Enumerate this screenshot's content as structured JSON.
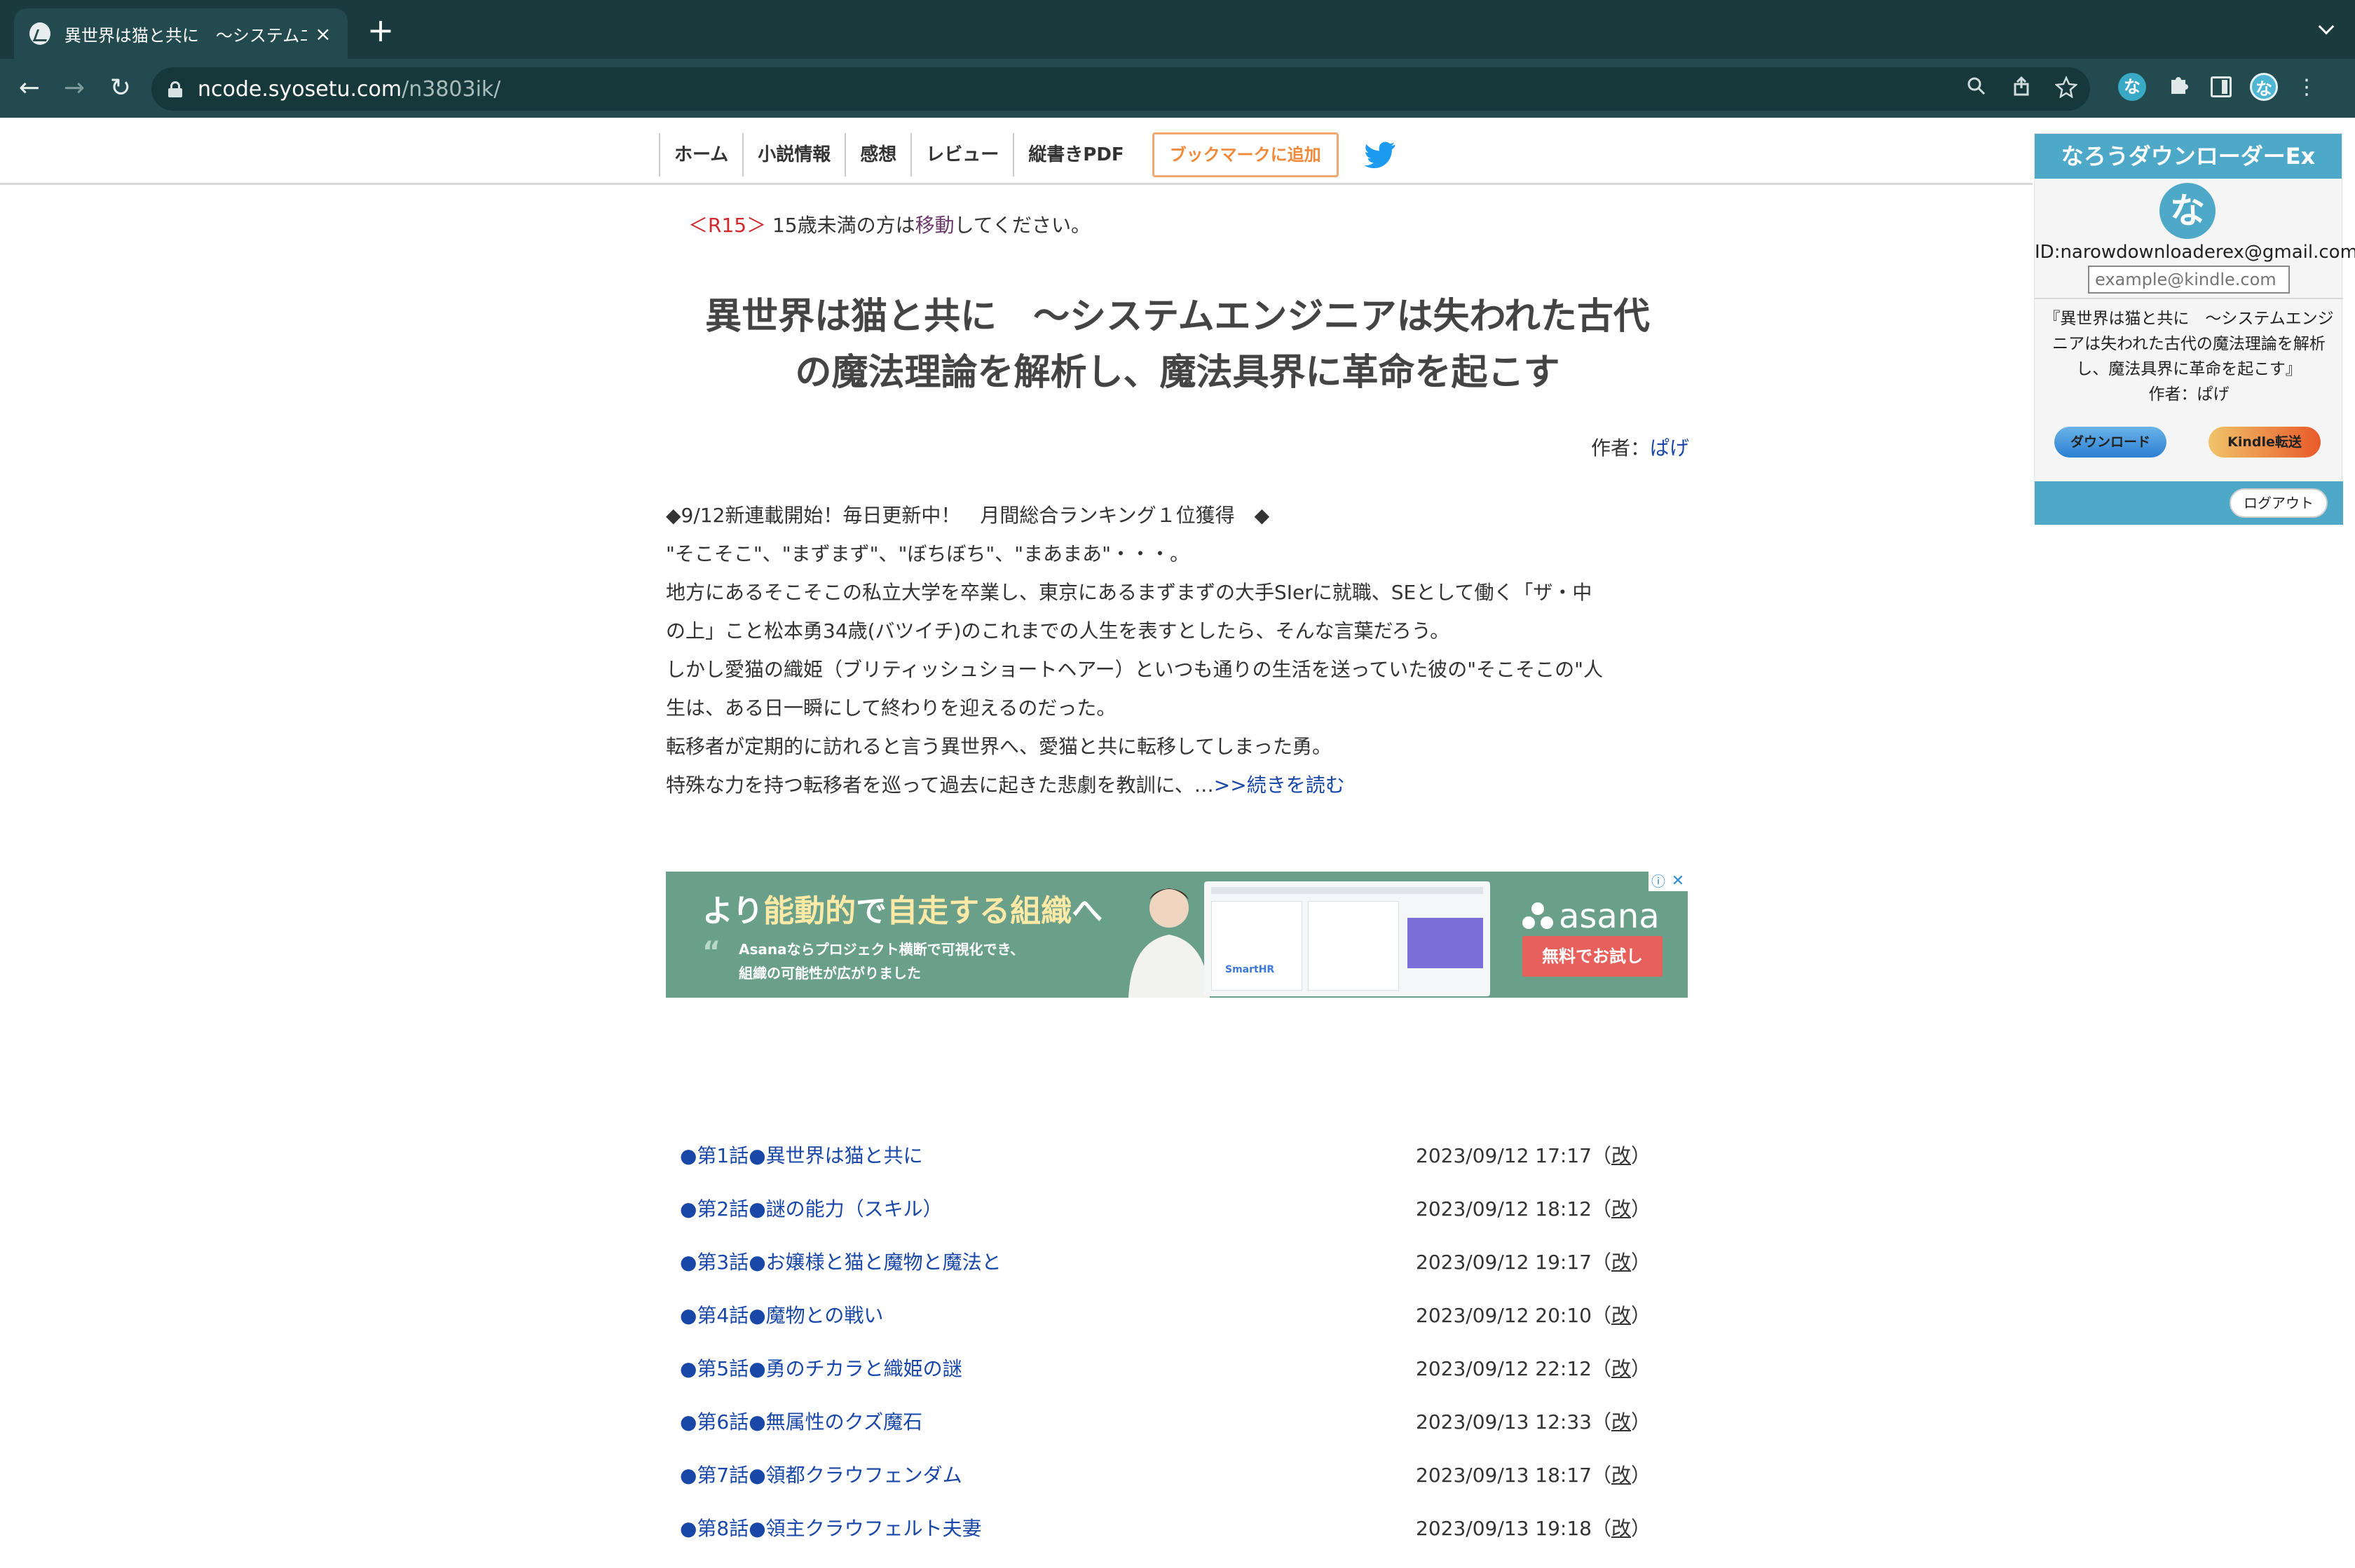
{
  "browser": {
    "tab_title": "異世界は猫と共に　〜システムエンジニア",
    "close_glyph": "×",
    "new_tab_glyph": "+",
    "url_host": "ncode.syosetu.com",
    "url_path": "/n3803ik/",
    "back_glyph": "←",
    "forward_glyph": "→",
    "reload_glyph": "↻"
  },
  "nav": {
    "items": [
      "ホーム",
      "小説情報",
      "感想",
      "レビュー",
      "縦書きPDF"
    ],
    "bookmark": "ブックマークに追加"
  },
  "notice": {
    "tag": "＜R15＞",
    "text_before": " 15歳未満の方は",
    "link": "移動",
    "text_after": "してください。"
  },
  "novel": {
    "title_line1": "異世界は猫と共に　〜システムエンジニアは失われた古代",
    "title_line2": "の魔法理論を解析し、魔法具界に革命を起こす",
    "author_label": "作者：",
    "author_name": "ぱげ",
    "synopsis": [
      "◆9/12新連載開始！毎日更新中！　月間総合ランキング１位獲得　◆",
      "\"そこそこ\"、\"まずまず\"、\"ぼちぼち\"、\"まあまあ\"・・・。",
      "地方にあるそこそこの私立大学を卒業し、東京にあるまずまずの大手SIerに就職、SEとして働く「ザ・中",
      "の上」こと松本勇34歳(バツイチ)のこれまでの人生を表すとしたら、そんな言葉だろう。",
      "しかし愛猫の織姫（ブリティッシュショートヘアー）といつも通りの生活を送っていた彼の\"そこそこの\"人",
      "生は、ある日一瞬にして終わりを迎えるのだった。",
      "転移者が定期的に訪れると言う異世界へ、愛猫と共に転移してしまった勇。",
      "特殊な力を持つ転移者を巡って過去に起きた悲劇を教訓に、…"
    ],
    "read_more": ">>続きを読む"
  },
  "ad": {
    "headline_pre": "より",
    "headline_hl1": "能動的",
    "headline_mid": "で",
    "headline_hl2": "自走する組織",
    "headline_post": "へ",
    "body_line1": "Asanaならプロジェクト横断で可視化でき、",
    "body_line2": "組織の可能性が広がりました",
    "brand": "asana",
    "cta": "無料でお試し",
    "smarthr": "SmartHR"
  },
  "chapters": [
    {
      "title": "●第1話●異世界は猫と共に",
      "date": "2023/09/12 17:17",
      "rev": "改"
    },
    {
      "title": "●第2話●謎の能力（スキル）",
      "date": "2023/09/12 18:12",
      "rev": "改"
    },
    {
      "title": "●第3話●お嬢様と猫と魔物と魔法と",
      "date": "2023/09/12 19:17",
      "rev": "改"
    },
    {
      "title": "●第4話●魔物との戦い",
      "date": "2023/09/12 20:10",
      "rev": "改"
    },
    {
      "title": "●第5話●勇のチカラと織姫の謎",
      "date": "2023/09/12 22:12",
      "rev": "改"
    },
    {
      "title": "●第6話●無属性のクズ魔石",
      "date": "2023/09/13 12:33",
      "rev": "改"
    },
    {
      "title": "●第7話●領都クラウフェンダム",
      "date": "2023/09/13 18:17",
      "rev": "改"
    },
    {
      "title": "●第8話●領主クラウフェルト夫妻",
      "date": "2023/09/13 19:18",
      "rev": "改"
    }
  ],
  "extension": {
    "header": "なろうダウンローダーEx",
    "logo_char": "な",
    "id_text": "ID:narowdownloaderex@gmail.com",
    "email_placeholder": "example@kindle.com",
    "book_title": "『異世界は猫と共に　〜システムエンジニアは失われた古代の魔法理論を解析し、魔法具界に革命を起こす』",
    "book_author": "作者：ぱげ",
    "download": "ダウンロード",
    "kindle": "Kindle転送",
    "logout": "ログアウト"
  }
}
